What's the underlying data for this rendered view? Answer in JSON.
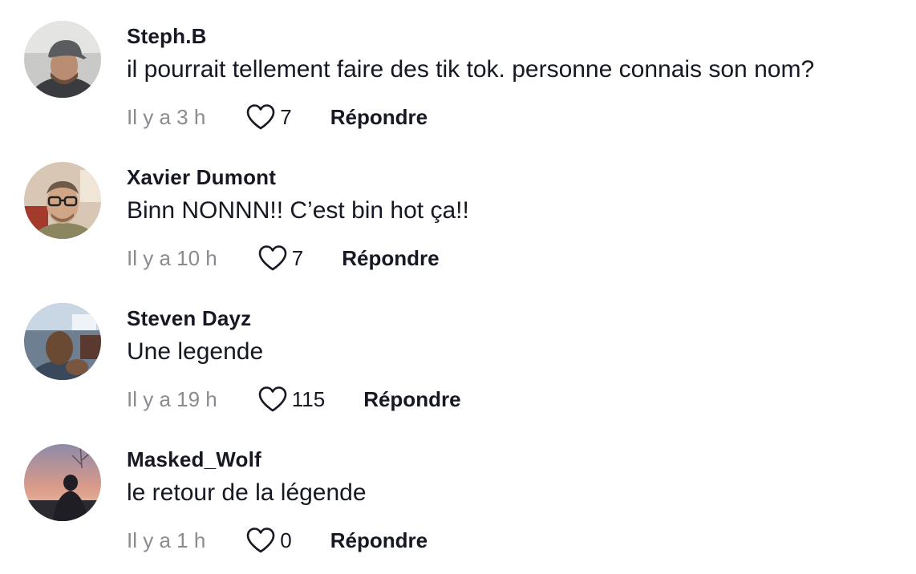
{
  "comments": [
    {
      "username": "Steph.B",
      "text": "il pourrait tellement faire des tik tok. personne connais son nom?",
      "time": "Il y a 3 h",
      "likes": "7",
      "reply_label": "Répondre",
      "avatar_icon": "avatar-photo-man-with-cap"
    },
    {
      "username": "Xavier Dumont",
      "text": "Binn NONNN!! C’est bin hot ça!!",
      "time": "Il y a 10 h",
      "likes": "7",
      "reply_label": "Répondre",
      "avatar_icon": "avatar-photo-man-with-glasses"
    },
    {
      "username": "Steven Dayz",
      "text": "Une legende",
      "time": "Il y a 19 h",
      "likes": "115",
      "reply_label": "Répondre",
      "avatar_icon": "avatar-photo-man-in-car"
    },
    {
      "username": "Masked_Wolf",
      "text": "le retour de la légende",
      "time": "Il y a 1 h",
      "likes": "0",
      "reply_label": "Répondre",
      "avatar_icon": "avatar-photo-silhouette-sunset"
    }
  ],
  "colors": {
    "text_primary": "#161823",
    "text_secondary": "#8a8b91",
    "heart_outline": "#161823",
    "background": "#ffffff"
  }
}
